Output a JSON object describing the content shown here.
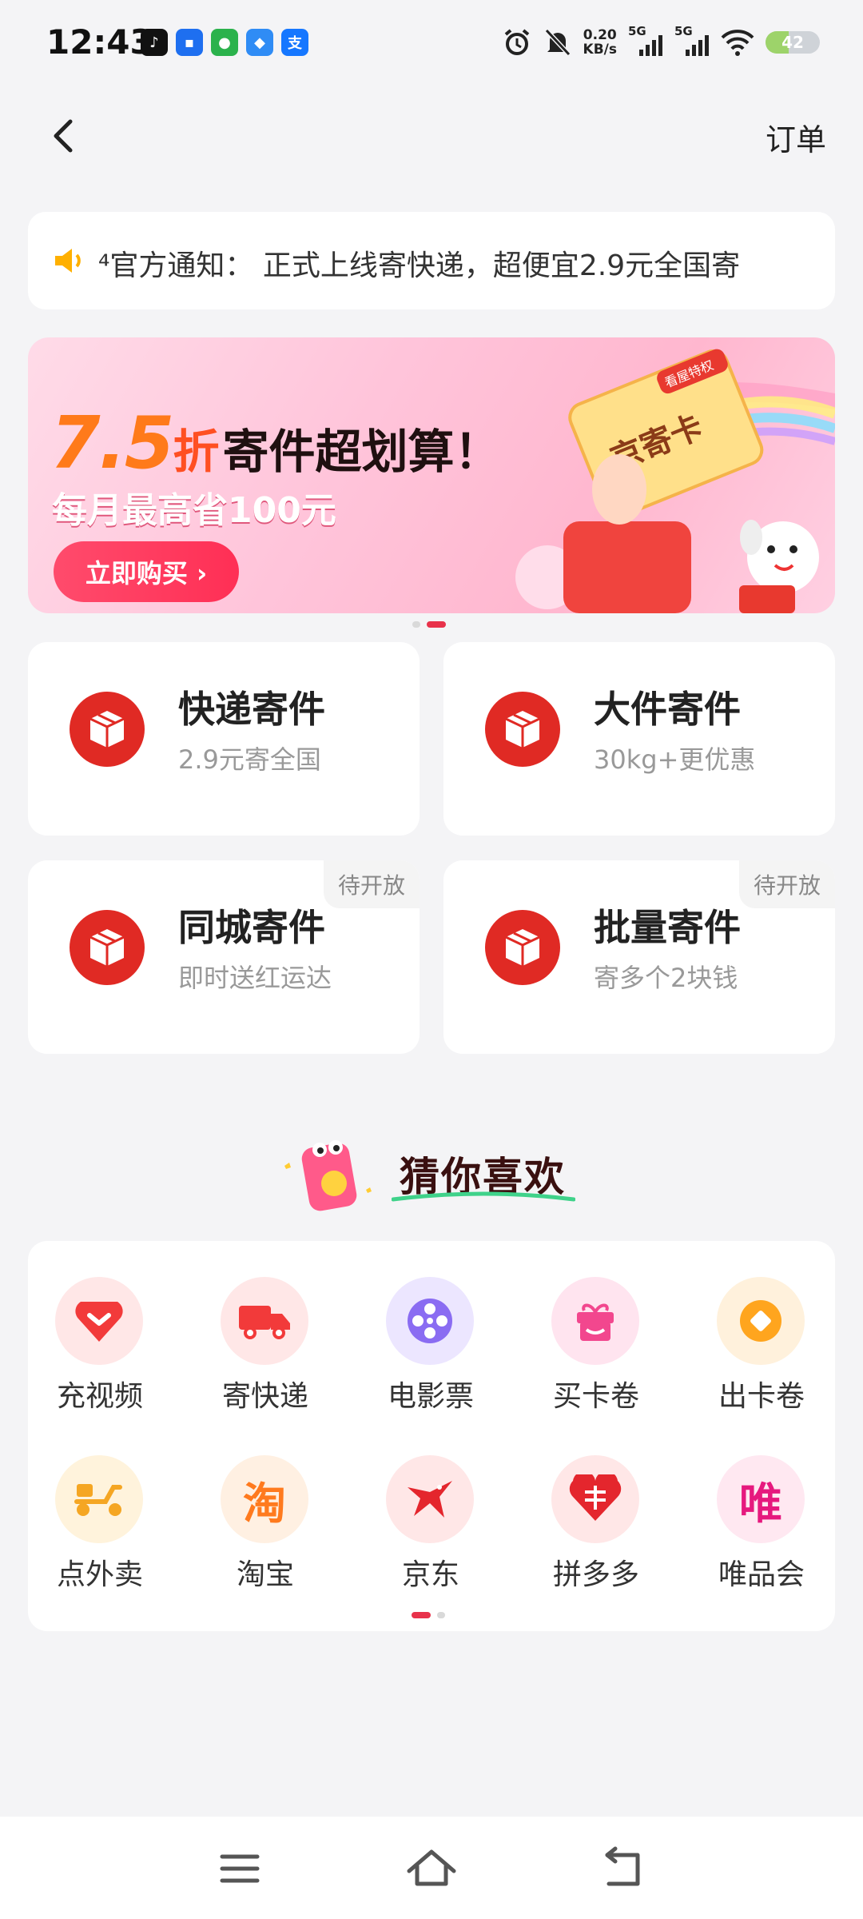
{
  "status_bar": {
    "time": "12:43",
    "net_speed_value": "0.20",
    "net_speed_unit": "KB/s",
    "signal1": "5G",
    "signal2": "5G",
    "battery": "42"
  },
  "header": {
    "orders_label": "订单"
  },
  "notice": {
    "text": "⁴官方通知：  正式上线寄快递，超便宜2.9元全国寄"
  },
  "banner": {
    "discount": "7.5",
    "discount_unit": "折",
    "title": "寄件超划算！",
    "subtitle": "每月最高省100元",
    "cta": "立即购买 ›",
    "card_tag": "看屋特权",
    "card_label": "京寄卡"
  },
  "services": [
    {
      "title": "快递寄件",
      "subtitle": "2.9元寄全国",
      "badge": ""
    },
    {
      "title": "大件寄件",
      "subtitle": "30kg+更优惠",
      "badge": ""
    },
    {
      "title": "同城寄件",
      "subtitle": "即时送红运达",
      "badge": "待开放"
    },
    {
      "title": "批量寄件",
      "subtitle": "寄多个2块钱",
      "badge": "待开放"
    }
  ],
  "recommend": {
    "title": "猜你喜欢"
  },
  "apps": [
    {
      "label": "充视频",
      "icon": "heart-video-icon",
      "bg": "#ffe7e7",
      "color": "#f23a3a"
    },
    {
      "label": "寄快递",
      "icon": "truck-icon",
      "bg": "#ffe7e7",
      "color": "#f23a3a"
    },
    {
      "label": "电影票",
      "icon": "film-reel-icon",
      "bg": "#ece6ff",
      "color": "#7a5cf0"
    },
    {
      "label": "买卡卷",
      "icon": "gift-icon",
      "bg": "#ffe4ef",
      "color": "#f2478e"
    },
    {
      "label": "出卡卷",
      "icon": "coin-icon",
      "bg": "#fff1dc",
      "color": "#ff9a1e"
    },
    {
      "label": "点外卖",
      "icon": "scooter-icon",
      "bg": "#fff3dc",
      "color": "#f5a623"
    },
    {
      "label": "淘宝",
      "icon": "taobao-icon",
      "bg": "#fff0e2",
      "color": "#ff7a1e"
    },
    {
      "label": "京东",
      "icon": "jd-icon",
      "bg": "#ffe7e7",
      "color": "#e4262d"
    },
    {
      "label": "拼多多",
      "icon": "pdd-icon",
      "bg": "#ffe7e7",
      "color": "#e4262d"
    },
    {
      "label": "唯品会",
      "icon": "vip-icon",
      "bg": "#ffe8f1",
      "color": "#e6197e"
    }
  ],
  "app_glyphs": {
    "taobao": "淘",
    "vip": "唯"
  },
  "colors": {
    "accent": "#e02a24",
    "page_bg": "#f4f4f6",
    "dot_active": "#e8324b"
  }
}
